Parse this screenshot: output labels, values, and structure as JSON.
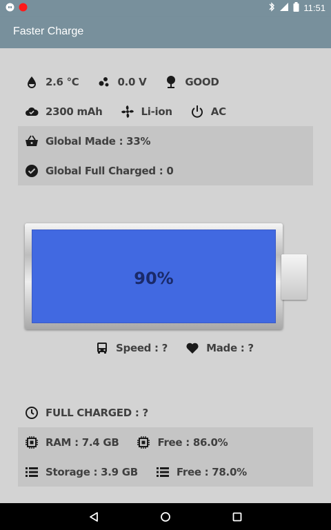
{
  "status_bar": {
    "time": "11:51"
  },
  "app": {
    "title": "Faster Charge"
  },
  "stats": {
    "temperature": "2.6 °C",
    "voltage": "0.0 V",
    "health": "GOOD",
    "capacity": "2300 mAh",
    "technology": "Li-ion",
    "plug": "AC",
    "global_made": "Global Made : 33%",
    "global_full_charged": "Global Full Charged : 0"
  },
  "battery": {
    "percent_label": "90%",
    "level": 0.9
  },
  "speed": {
    "speed_label": "Speed : ?",
    "made_label": "Made : ?"
  },
  "bottom": {
    "full_charged": "FULL CHARGED : ?",
    "ram": "RAM : 7.4 GB",
    "ram_free": "Free : 86.0%",
    "storage": "Storage : 3.9 GB",
    "storage_free": "Free : 78.0%"
  },
  "icons": {
    "temperature": "drop-icon",
    "voltage": "bubbles-icon",
    "health": "tree-icon",
    "capacity": "cloud-icon",
    "technology": "fan-icon",
    "plug": "power-icon",
    "global_made": "basket-icon",
    "global_full_charged": "check-circle-icon",
    "speed": "bus-icon",
    "made": "heart-icon",
    "full_charged": "clock-icon",
    "ram": "chip-icon",
    "storage": "list-icon"
  },
  "colors": {
    "app_bar": "#78909c",
    "battery_fill": "#4169e1"
  }
}
